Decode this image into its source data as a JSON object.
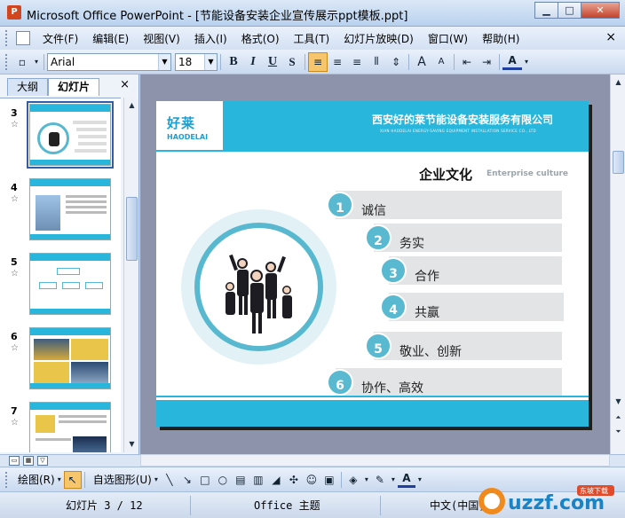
{
  "window": {
    "title": "Microsoft Office PowerPoint - [节能设备安装企业宣传展示ppt模板.ppt]",
    "app_icon_letter": "P"
  },
  "menu": {
    "items": [
      "文件(F)",
      "编辑(E)",
      "视图(V)",
      "插入(I)",
      "格式(O)",
      "工具(T)",
      "幻灯片放映(D)",
      "窗口(W)",
      "帮助(H)"
    ],
    "close": "×"
  },
  "toolbar": {
    "font_name": "Arial",
    "font_size": "18",
    "bold": "B",
    "italic": "I",
    "underline": "U",
    "shadow": "S",
    "grow_font": "A",
    "shrink_font": "A",
    "font_color": "A"
  },
  "left_pane": {
    "tabs": [
      "大纲",
      "幻灯片"
    ],
    "active_tab": "幻灯片",
    "close": "×",
    "thumbnails": [
      {
        "number": "3",
        "selected": true
      },
      {
        "number": "4",
        "selected": false
      },
      {
        "number": "5",
        "selected": false
      },
      {
        "number": "6",
        "selected": false
      },
      {
        "number": "7",
        "selected": false
      }
    ]
  },
  "slide": {
    "logo_text": "好莱",
    "logo_sub": "HAODELAI",
    "company_name": "西安好的莱节能设备安装服务有限公司",
    "company_name_en": "XIAN HAODELAI ENERGY-SAVING EQUIPMENT INSTALLATION SERVICE CO., LTD",
    "section_title": "企业文化",
    "section_title_en": "Enterprise culture",
    "items": [
      {
        "num": "1",
        "text": "诚信"
      },
      {
        "num": "2",
        "text": "务实"
      },
      {
        "num": "3",
        "text": "合作"
      },
      {
        "num": "4",
        "text": "共赢"
      },
      {
        "num": "5",
        "text": "敬业、创新"
      },
      {
        "num": "6",
        "text": "协作、高效"
      }
    ],
    "colors": {
      "accent": "#28b6dc",
      "ring": "#57b8cf",
      "item_bg": "#e3e4e6"
    }
  },
  "drawbar": {
    "draw_label": "绘图(R)",
    "autoshape_label": "自选图形(U)"
  },
  "status": {
    "slide_info": "幻灯片 3 / 12",
    "theme": "Office 主题",
    "language": "中文(中国)"
  },
  "watermark": {
    "text": "uzzf.com",
    "sub": "东坡下载"
  }
}
